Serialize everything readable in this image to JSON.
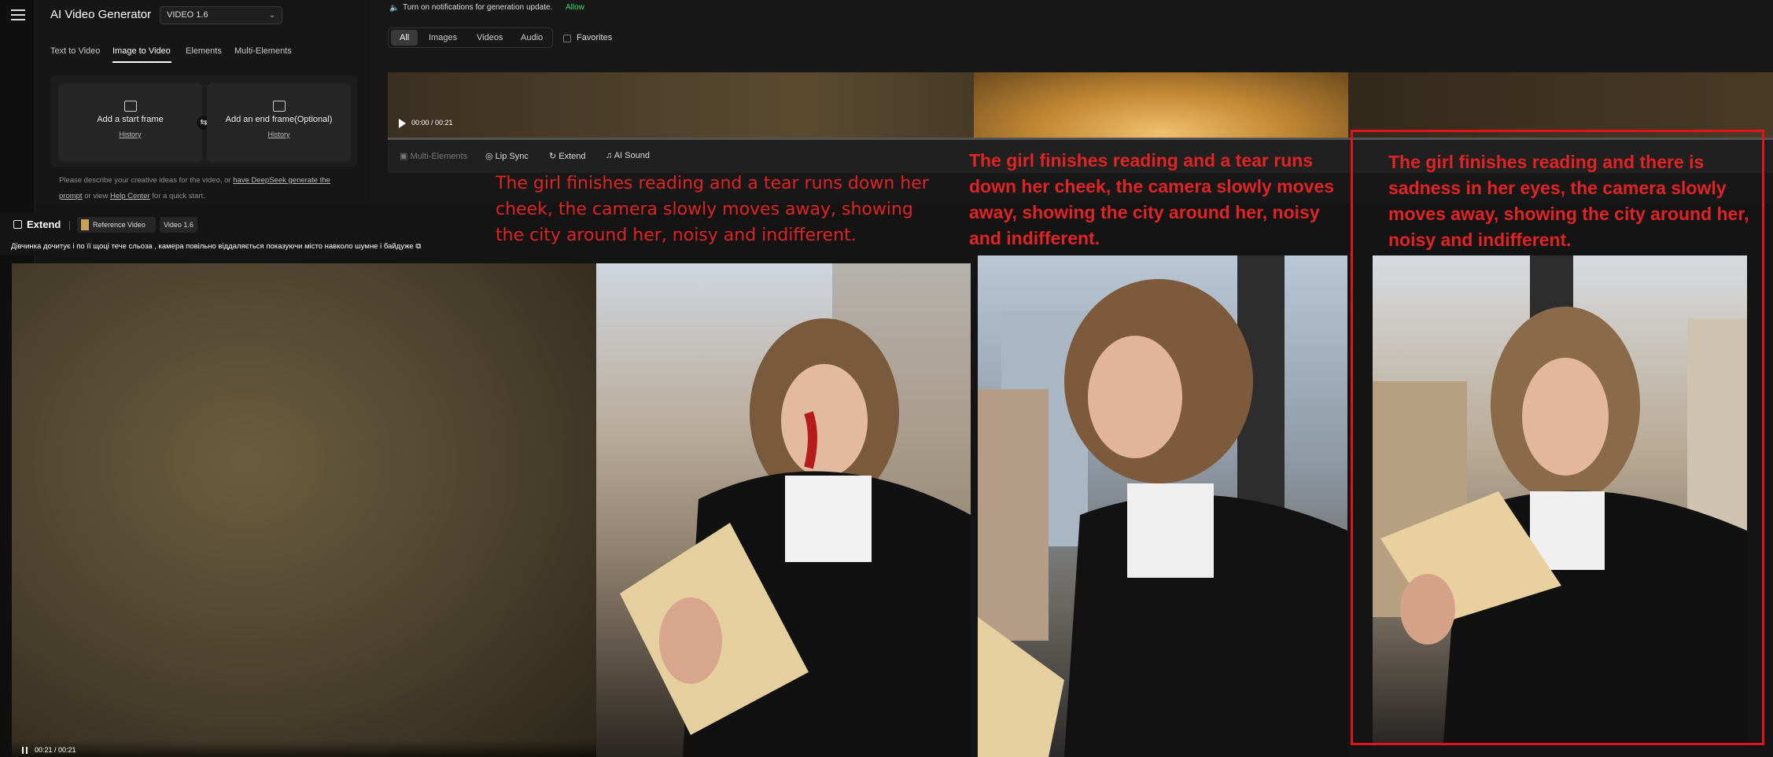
{
  "app": {
    "title": "AI Video Generator",
    "model": "VIDEO 1.6"
  },
  "mode_tabs": [
    "Text to Video",
    "Image to Video",
    "Elements",
    "Multi-Elements"
  ],
  "frames": {
    "start_label": "Add a start frame",
    "end_label": "Add an end frame(Optional)",
    "history": "History"
  },
  "description": {
    "part1": "Please describe your creative ideas for the video, or ",
    "link1": "have DeepSeek generate the prompt",
    "part2": " or view ",
    "link2": "Help Center",
    "part3": " for a quick start."
  },
  "notification": {
    "text": "Turn on notifications for generation update.",
    "allow": "Allow"
  },
  "filters": {
    "tabs": [
      "All",
      "Images",
      "Videos",
      "Audio"
    ],
    "favorites": "Favorites"
  },
  "strip_player": {
    "time": "00:00 / 00:21"
  },
  "video_toolbar": [
    "Multi-Elements",
    "Lip Sync",
    "Extend",
    "AI Sound"
  ],
  "captions": {
    "c1": "The girl finishes reading and a tear runs down her cheek, the camera slowly moves away, showing the city around her, noisy and indifferent.",
    "c2": "The girl finishes reading and a tear runs down her cheek, the camera slowly moves away, showing the city around her, noisy and indifferent.",
    "c3": "The girl finishes reading and there is sadness in her eyes, the camera slowly moves away, showing the city around her, noisy and indifferent."
  },
  "extend": {
    "title": "Extend",
    "reference": "Reference Video",
    "version": "Video 1.6",
    "prompt": "Дівчинка дочитує і по її щоці тече сльоза , камера повільно віддаляється показуючи місто навколо шумне і байдуже"
  },
  "main_player": {
    "time": "00:21 / 00:21"
  },
  "colors": {
    "caption": "#e02424",
    "highlight_box": "#e3131b",
    "allow": "#3ddc6e"
  }
}
